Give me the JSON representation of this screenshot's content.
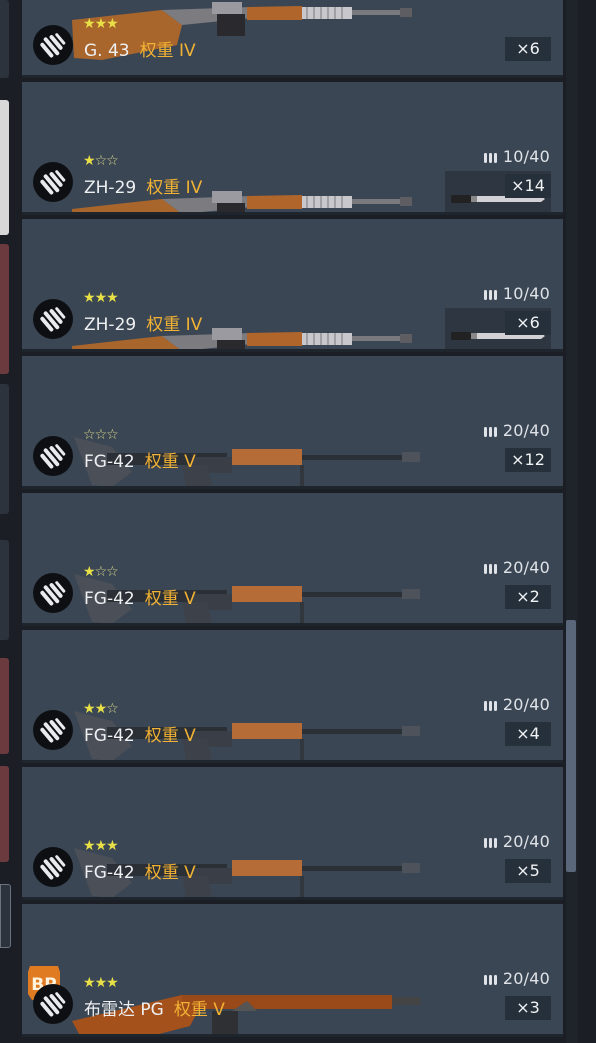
{
  "colors": {
    "card": "#3b4654",
    "weight": "#f2b233",
    "star": "#e8e046",
    "panel": "#26303a"
  },
  "cards": [
    {
      "name": "G. 43",
      "weight": "权重 IV",
      "stars": 3,
      "count": "×6",
      "ammo": "",
      "gun": "rifle-top",
      "mod": false,
      "badge": "bullets-icon"
    },
    {
      "name": "ZH-29",
      "weight": "权重 IV",
      "stars": 1,
      "count": "×14",
      "ammo": "10/40",
      "gun": "rifle",
      "mod": true,
      "badge": "bullets-icon"
    },
    {
      "name": "ZH-29",
      "weight": "权重 IV",
      "stars": 3,
      "count": "×6",
      "ammo": "10/40",
      "gun": "rifle",
      "mod": true,
      "badge": "bullets-icon"
    },
    {
      "name": "FG-42",
      "weight": "权重 V",
      "stars": 0,
      "count": "×12",
      "ammo": "20/40",
      "gun": "fg42",
      "mod": false,
      "badge": "bullets-icon"
    },
    {
      "name": "FG-42",
      "weight": "权重 V",
      "stars": 1,
      "count": "×2",
      "ammo": "20/40",
      "gun": "fg42",
      "mod": false,
      "badge": "bullets-icon"
    },
    {
      "name": "FG-42",
      "weight": "权重 V",
      "stars": 2,
      "count": "×4",
      "ammo": "20/40",
      "gun": "fg42",
      "mod": false,
      "badge": "bullets-icon"
    },
    {
      "name": "FG-42",
      "weight": "权重 V",
      "stars": 3,
      "count": "×5",
      "ammo": "20/40",
      "gun": "fg42",
      "mod": false,
      "badge": "bullets-icon"
    },
    {
      "name": "布雷达 PG",
      "weight": "权重 V",
      "stars": 3,
      "count": "×3",
      "ammo": "20/40",
      "gun": "breda",
      "mod": false,
      "badge": "bullets-icon",
      "bp": "BP"
    }
  ]
}
